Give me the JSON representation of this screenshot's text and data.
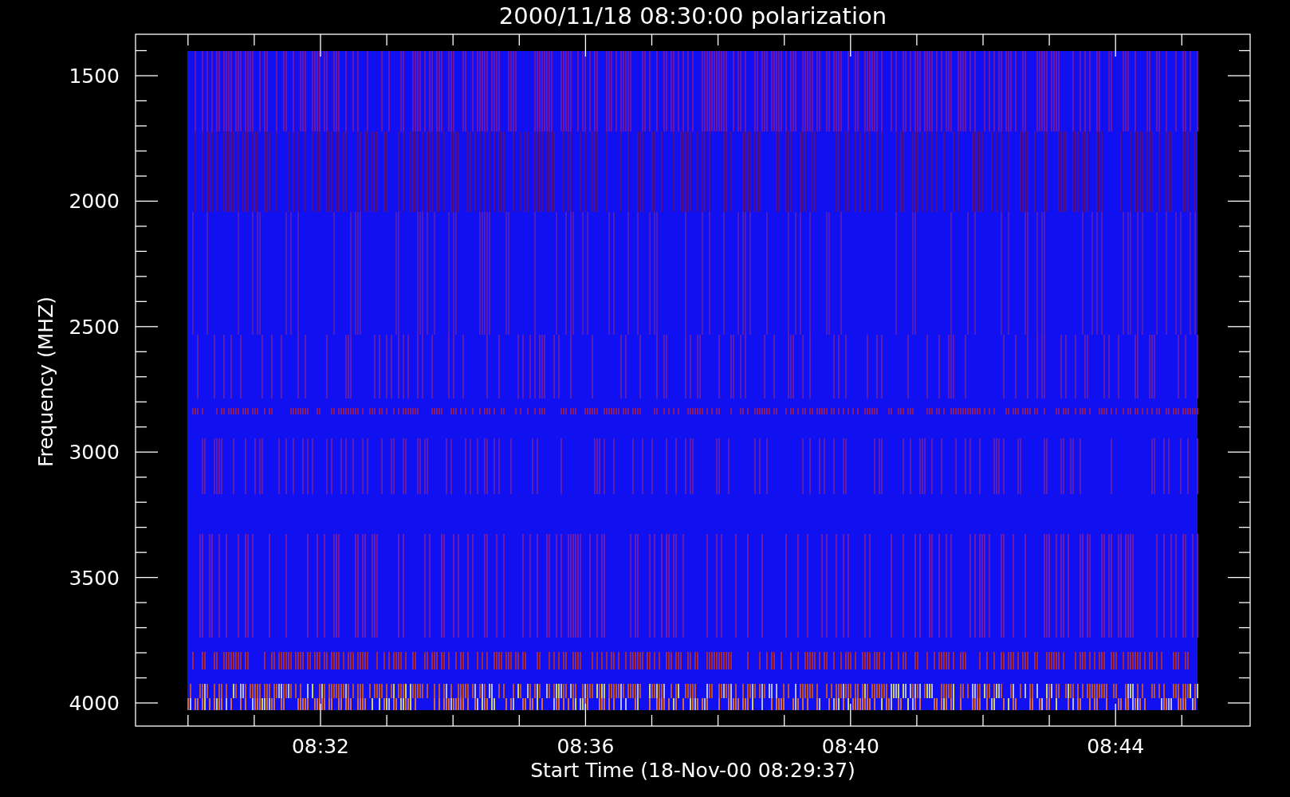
{
  "title": "2000/11/18 08:30:00 polarization",
  "y_axis": {
    "label": "Frequency (MHZ)",
    "ticks": [
      "1500",
      "2000",
      "2500",
      "3000",
      "3500",
      "4000"
    ]
  },
  "x_axis": {
    "label": "Start Time (18-Nov-00 08:29:37)",
    "ticks": [
      "08:32",
      "08:36",
      "08:40",
      "08:44"
    ]
  }
}
